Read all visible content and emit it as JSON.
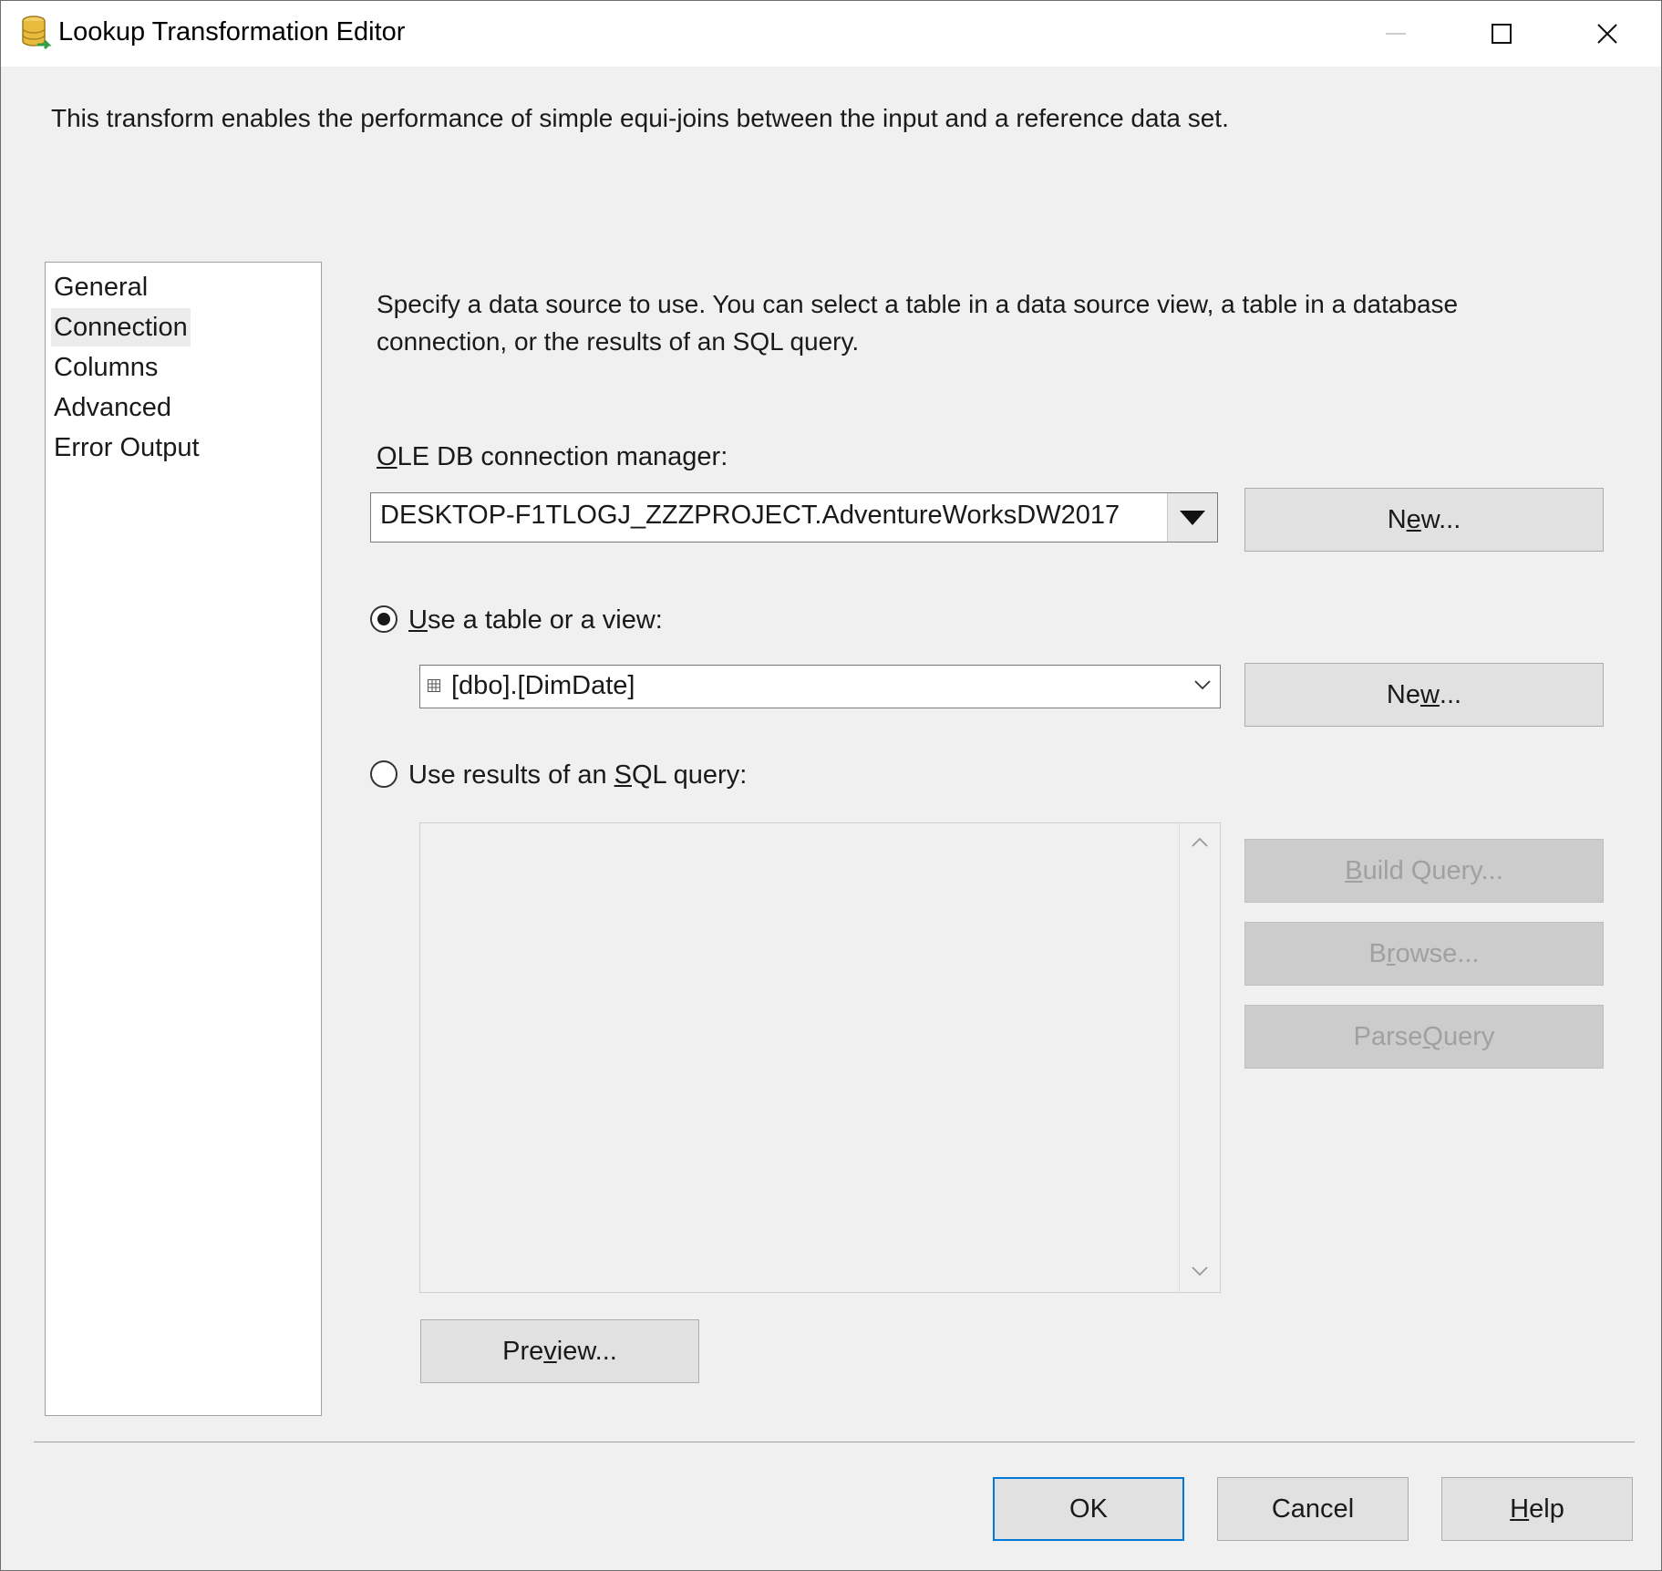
{
  "window": {
    "title": "Lookup Transformation Editor",
    "app_icon": "database-lookup-icon"
  },
  "description": "This transform enables the performance of simple equi-joins between the input and a reference data set.",
  "nav": {
    "items": [
      {
        "label": "General",
        "selected": false
      },
      {
        "label": "Connection",
        "selected": true
      },
      {
        "label": "Columns",
        "selected": false
      },
      {
        "label": "Advanced",
        "selected": false
      },
      {
        "label": "Error Output",
        "selected": false
      }
    ]
  },
  "connection": {
    "intro": "Specify a data source to use. You can select a table in a data source view, a table in a database connection, or the results of an SQL query.",
    "manager_label_prefix": "O",
    "manager_label_rest": "LE DB connection manager:",
    "manager_value": "DESKTOP-F1TLOGJ_ZZZPROJECT.AdventureWorksDW2017",
    "new_button_1": {
      "pre": "N",
      "mnemonic": "e",
      "post": "w..."
    },
    "use_table_label": {
      "mnemonic": "U",
      "rest": "se a table or a view:"
    },
    "use_table_selected": true,
    "table_value": "[dbo].[DimDate]",
    "new_button_2": {
      "pre": "Ne",
      "mnemonic": "w",
      "post": "..."
    },
    "use_sql_label": {
      "pre": "Use results of an ",
      "mnemonic": "S",
      "post": "QL query:"
    },
    "use_sql_selected": false,
    "sql_query_text": "",
    "build_query": {
      "mnemonic": "B",
      "rest": "uild Query..."
    },
    "browse": {
      "pre": "B",
      "mnemonic": "r",
      "post": "owse..."
    },
    "parse_query": {
      "pre": "Parse ",
      "mnemonic": "Q",
      "post": "uery"
    },
    "preview": {
      "pre": "Pre",
      "mnemonic": "v",
      "post": "iew..."
    }
  },
  "footer": {
    "ok": "OK",
    "cancel": "Cancel",
    "help": {
      "mnemonic": "H",
      "rest": "elp"
    }
  },
  "colors": {
    "accent": "#0078d7",
    "dialog_bg": "#f0f0f0",
    "disabled_text": "#a0a0a0"
  }
}
